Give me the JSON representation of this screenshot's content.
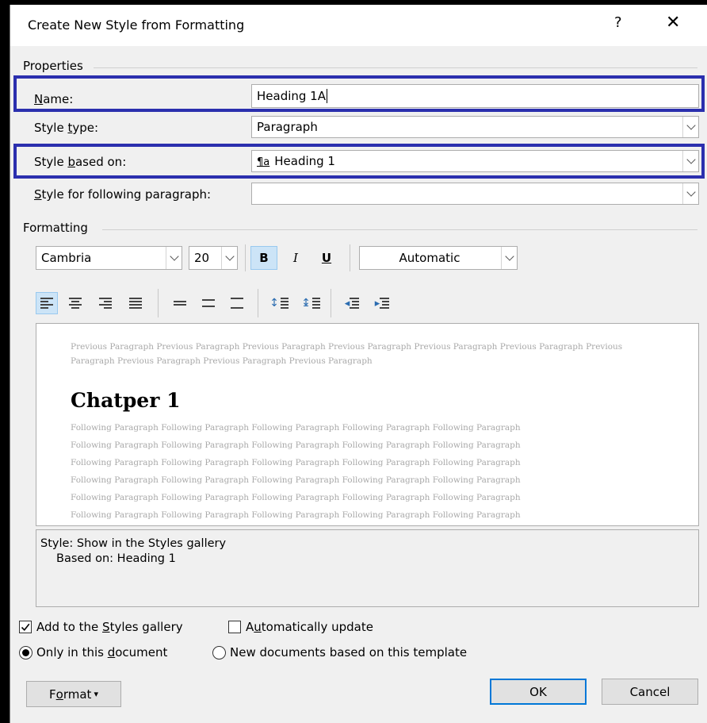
{
  "window": {
    "title": "Create New Style from Formatting",
    "help_glyph": "?",
    "close_glyph": "✕"
  },
  "properties": {
    "section_label": "Properties",
    "name_label_u": "N",
    "name_label_rest": "ame:",
    "name_value": "Heading 1A",
    "style_type_label_pre": "Style ",
    "style_type_label_u": "t",
    "style_type_label_rest": "ype:",
    "style_type_value": "Paragraph",
    "based_on_label_pre": "Style ",
    "based_on_label_u": "b",
    "based_on_label_rest": "ased on:",
    "based_on_icon": "¶a",
    "based_on_value": "Heading 1",
    "following_label_u": "S",
    "following_label_rest": "tyle for following paragraph:",
    "following_value": ""
  },
  "formatting": {
    "section_label": "Formatting",
    "font": "Cambria",
    "size": "20",
    "bold": "B",
    "italic": "I",
    "underline": "U",
    "color": "Automatic"
  },
  "preview": {
    "previous_text": "Previous Paragraph Previous Paragraph Previous Paragraph Previous Paragraph Previous Paragraph Previous Paragraph Previous Paragraph Previous Paragraph Previous Paragraph Previous Paragraph",
    "heading": "Chatper 1",
    "following_lines": [
      "Following Paragraph Following Paragraph Following Paragraph Following Paragraph Following Paragraph",
      "Following Paragraph Following Paragraph Following Paragraph Following Paragraph Following Paragraph",
      "Following Paragraph Following Paragraph Following Paragraph Following Paragraph Following Paragraph",
      "Following Paragraph Following Paragraph Following Paragraph Following Paragraph Following Paragraph",
      "Following Paragraph Following Paragraph Following Paragraph Following Paragraph Following Paragraph",
      "Following Paragraph Following Paragraph Following Paragraph Following Paragraph Following Paragraph"
    ]
  },
  "description": {
    "line1": "Style: Show in the Styles gallery",
    "line2": "Based on: Heading 1"
  },
  "options": {
    "add_gallery_pre": "Add to the ",
    "add_gallery_u": "S",
    "add_gallery_rest": "tyles gallery",
    "add_gallery_checked": true,
    "auto_update_pre": "A",
    "auto_update_u": "u",
    "auto_update_rest": "tomatically update",
    "auto_update_checked": false,
    "only_doc_pre": "Only in this ",
    "only_doc_u": "d",
    "only_doc_rest": "ocument",
    "only_doc_selected": true,
    "new_docs_label": "New documents based on this template"
  },
  "buttons": {
    "format_pre": "F",
    "format_u": "o",
    "format_rest": "rmat",
    "format_arrow": "▾",
    "ok": "OK",
    "cancel": "Cancel"
  },
  "colors": {
    "highlight": "#2b2fae",
    "active_toggle": "#cce4f7",
    "ok_border": "#0078d7"
  }
}
